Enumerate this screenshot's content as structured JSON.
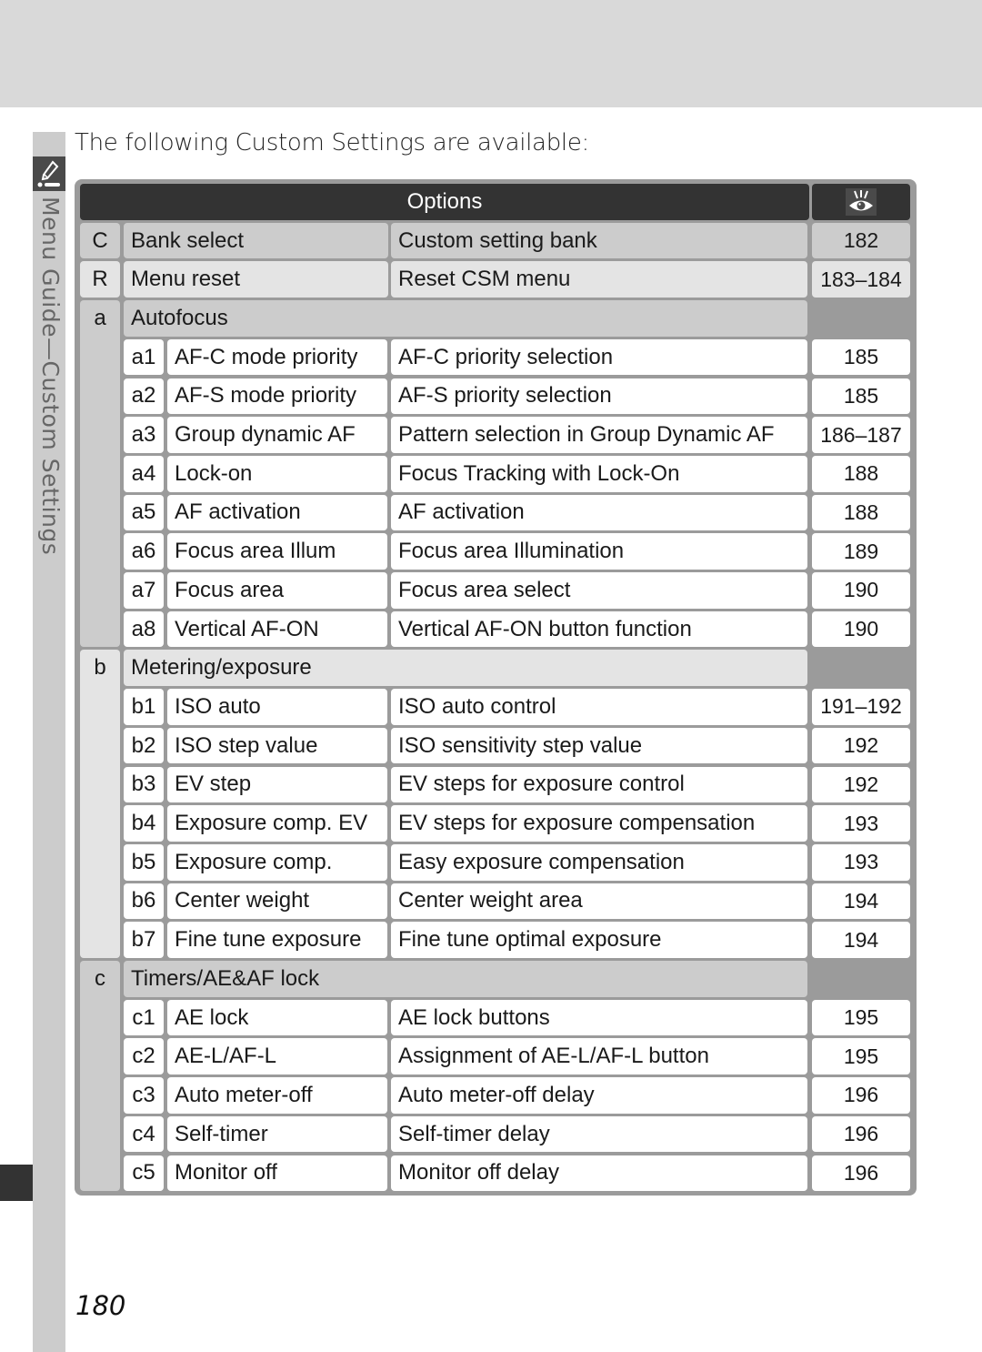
{
  "page": {
    "intro_text": "The following Custom Settings are available:",
    "side_tab_title": "Menu Guide—Custom Settings",
    "side_tab_icon": "pencil-icon",
    "page_number": "180"
  },
  "table": {
    "header": {
      "options_label": "Options",
      "page_column_icon": "eye-icon"
    },
    "top_rows": [
      {
        "code": "C",
        "name": "Bank select",
        "description": "Custom setting bank",
        "page": "182"
      },
      {
        "code": "R",
        "name": "Menu reset",
        "description": "Reset CSM menu",
        "page": "183–184"
      }
    ],
    "groups": [
      {
        "code": "a",
        "title": "Autofocus",
        "items": [
          {
            "code": "a1",
            "name": "AF-C mode priority",
            "description": "AF-C priority selection",
            "page": "185"
          },
          {
            "code": "a2",
            "name": "AF-S mode priority",
            "description": "AF-S priority selection",
            "page": "185"
          },
          {
            "code": "a3",
            "name": "Group dynamic AF",
            "description": "Pattern selection in Group Dynamic AF",
            "page": "186–187"
          },
          {
            "code": "a4",
            "name": "Lock-on",
            "description": "Focus Tracking with Lock-On",
            "page": "188"
          },
          {
            "code": "a5",
            "name": "AF activation",
            "description": "AF activation",
            "page": "188"
          },
          {
            "code": "a6",
            "name": "Focus area Illum",
            "description": "Focus area Illumination",
            "page": "189"
          },
          {
            "code": "a7",
            "name": "Focus area",
            "description": "Focus area select",
            "page": "190"
          },
          {
            "code": "a8",
            "name": "Vertical AF-ON",
            "description": "Vertical AF-ON button function",
            "page": "190"
          }
        ]
      },
      {
        "code": "b",
        "title": "Metering/exposure",
        "items": [
          {
            "code": "b1",
            "name": "ISO auto",
            "description": "ISO auto control",
            "page": "191–192"
          },
          {
            "code": "b2",
            "name": "ISO step value",
            "description": "ISO sensitivity step value",
            "page": "192"
          },
          {
            "code": "b3",
            "name": "EV step",
            "description": "EV steps for exposure control",
            "page": "192"
          },
          {
            "code": "b4",
            "name": "Exposure comp. EV",
            "description": "EV steps for exposure compensation",
            "page": "193"
          },
          {
            "code": "b5",
            "name": "Exposure comp.",
            "description": "Easy exposure compensation",
            "page": "193"
          },
          {
            "code": "b6",
            "name": "Center weight",
            "description": "Center weight area",
            "page": "194"
          },
          {
            "code": "b7",
            "name": "Fine tune exposure",
            "description": "Fine tune optimal exposure",
            "page": "194"
          }
        ]
      },
      {
        "code": "c",
        "title": "Timers/AE&AF lock",
        "items": [
          {
            "code": "c1",
            "name": "AE lock",
            "description": "AE lock buttons",
            "page": "195"
          },
          {
            "code": "c2",
            "name": "AE-L/AF-L",
            "description": "Assignment of AE-L/AF-L button",
            "page": "195"
          },
          {
            "code": "c3",
            "name": "Auto meter-off",
            "description": "Auto meter-off delay",
            "page": "196"
          },
          {
            "code": "c4",
            "name": "Self-timer",
            "description": "Self-timer delay",
            "page": "196"
          },
          {
            "code": "c5",
            "name": "Monitor off",
            "description": "Monitor off delay",
            "page": "196"
          }
        ]
      }
    ]
  },
  "colors": {
    "header_bg": "#333333",
    "frame_bg": "#9b9b9b",
    "group_gray": "#cccccc",
    "row_light": "#e4e4e4",
    "row_white": "#ffffff"
  }
}
